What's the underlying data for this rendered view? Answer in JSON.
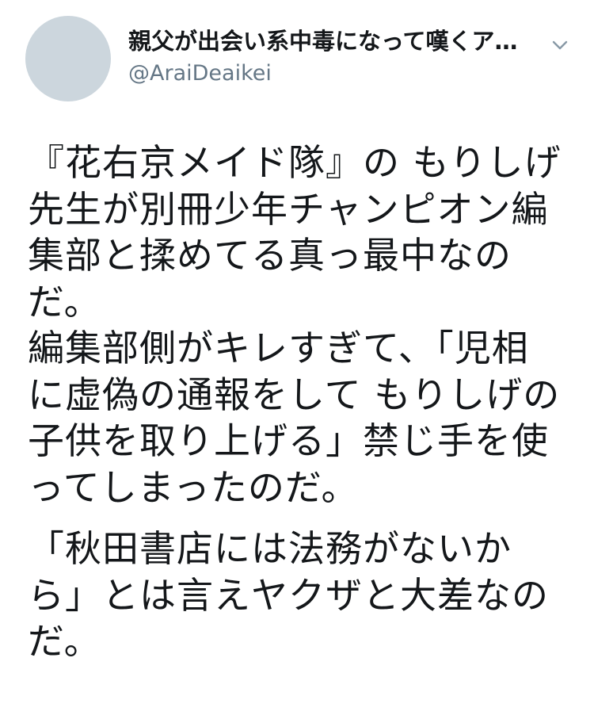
{
  "tweet": {
    "display_name": "親父が出会い系中毒になって嘆くア…",
    "handle": "@AraiDeaikei",
    "avatar_icon": "avatar-placeholder-icon",
    "menu_icon": "chevron-down-icon",
    "paragraphs": [
      {
        "lines": [
          "『花右京メイド隊』の もりしげ",
          "先生が別冊少年チャンピオン編",
          "集部と揉めてる真っ最中なの",
          "だ。",
          "編集部側がキレすぎて、「児相",
          "に虚偽の通報をして もりしげの",
          "子供を取り上げる」禁じ手を使",
          "ってしまったのだ。"
        ]
      },
      {
        "lines": [
          "「秋田書店には法務がないか",
          "ら」とは言えヤクザと大差なの",
          "だ。"
        ]
      }
    ]
  },
  "colors": {
    "text": "#14171a",
    "secondary": "#657786",
    "avatar_bg": "#ccd6dd"
  }
}
